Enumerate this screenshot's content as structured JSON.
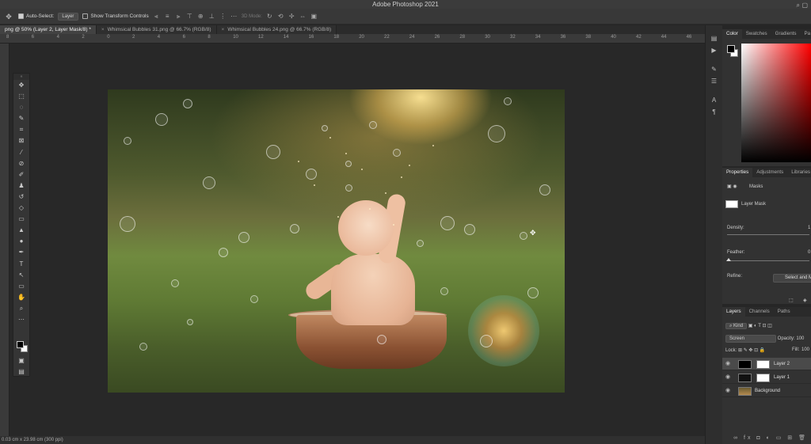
{
  "app": {
    "title": "Adobe Photoshop 2021"
  },
  "options_bar": {
    "auto_select_label": "Auto-Select:",
    "auto_select_checked": true,
    "auto_select_target": "Layer",
    "show_transform_label": "Show Transform Controls",
    "show_transform_checked": false,
    "mode_3d_label": "3D Mode:",
    "icons": [
      "move-tool-icon",
      "align-icons",
      "distribute-icons",
      "more-icon",
      "3d-orbit-icon",
      "share-icon",
      "search-icon"
    ]
  },
  "document_tabs": [
    {
      "label": "png @ 50% (Layer 2, Layer Mask/8) *",
      "active": true
    },
    {
      "label": "Whimsical Bubbles 31.png @ 66.7% (RGB/8)",
      "active": false
    },
    {
      "label": "Whimsical Bubbles 24.png @ 66.7% (RGB/8)",
      "active": false
    }
  ],
  "ruler_labels": [
    "8",
    "6",
    "4",
    "2",
    "0",
    "2",
    "4",
    "6",
    "8",
    "10",
    "12",
    "14",
    "16",
    "18",
    "20",
    "22",
    "24",
    "26",
    "28",
    "30",
    "32",
    "34",
    "36",
    "38",
    "40",
    "42",
    "44",
    "46"
  ],
  "status_bar": {
    "text": "0.03 cm x 23.98 cm (300 ppi)"
  },
  "tools": [
    "move-icon",
    "marquee-icon",
    "lasso-icon",
    "quick-select-icon",
    "crop-icon",
    "frame-icon",
    "eyedropper-icon",
    "healing-icon",
    "brush-icon",
    "stamp-icon",
    "history-brush-icon",
    "eraser-icon",
    "gradient-icon",
    "blur-icon",
    "dodge-icon",
    "pen-icon",
    "type-icon",
    "path-select-icon",
    "rectangle-icon",
    "hand-icon",
    "zoom-icon",
    "more-tools-icon"
  ],
  "color_panel": {
    "tabs": [
      "Color",
      "Swatches",
      "Gradients",
      "Pa"
    ],
    "fg_color": "#000000",
    "bg_color": "#ffffff",
    "hue_color": "#ff0000"
  },
  "properties_panel": {
    "tabs": [
      "Properties",
      "Adjustments",
      "Libraries"
    ],
    "section": "Masks",
    "mask_label": "Layer Mask",
    "density_label": "Density:",
    "density_value": "1",
    "feather_label": "Feather:",
    "feather_value": "0",
    "refine_label": "Refine:",
    "select_mask_button": "Select and M"
  },
  "layers_panel": {
    "tabs": [
      "Layers",
      "Channels",
      "Paths"
    ],
    "kind_filter": "Kind",
    "blend_mode": "Screen",
    "opacity_label": "Opacity:",
    "opacity_value": "100",
    "lock_label": "Lock:",
    "fill_label": "Fill:",
    "fill_value": "100",
    "layers": [
      {
        "name": "Layer 2",
        "selected": true,
        "has_mask": true
      },
      {
        "name": "Layer 1",
        "selected": false,
        "has_mask": true
      },
      {
        "name": "Background",
        "selected": false,
        "has_mask": false
      }
    ],
    "footer_icons": [
      "link-icon",
      "fx-icon",
      "mask-icon",
      "adjustment-icon",
      "group-icon",
      "new-layer-icon",
      "trash-icon"
    ]
  }
}
